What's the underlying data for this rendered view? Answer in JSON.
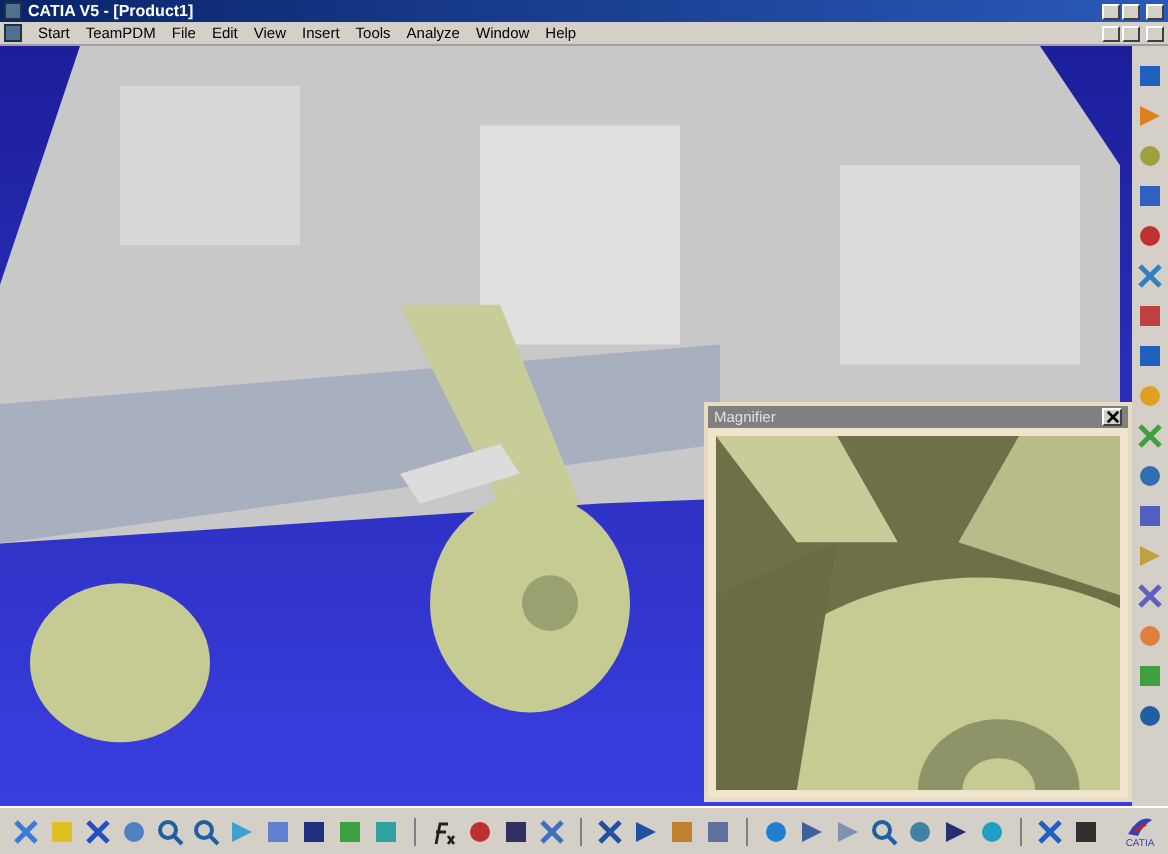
{
  "window": {
    "title": "CATIA V5 - [Product1]"
  },
  "menu": [
    "Start",
    "TeamPDM",
    "File",
    "Edit",
    "View",
    "Insert",
    "Tools",
    "Analyze",
    "Window",
    "Help"
  ],
  "magnifier": {
    "title": "Magnifier"
  },
  "logo": {
    "caption": "CATIA"
  }
}
